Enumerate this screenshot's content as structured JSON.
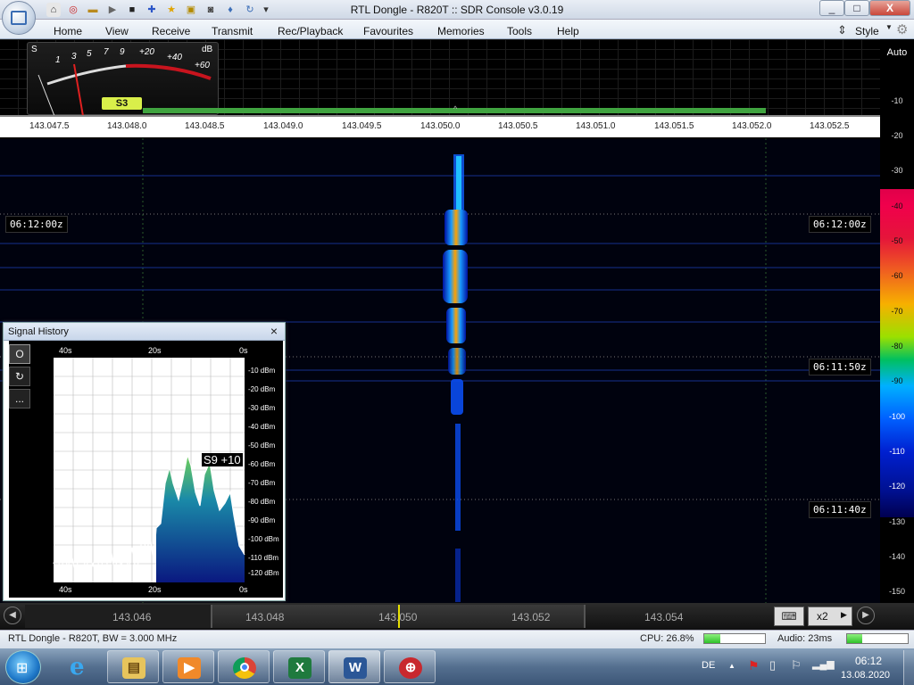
{
  "window": {
    "title": "RTL Dongle - R820T :: SDR Console v3.0.19",
    "controls": [
      "_",
      "□",
      "X"
    ]
  },
  "menu": {
    "items": [
      "Home",
      "View",
      "Receive",
      "Transmit",
      "Rec/Playback",
      "Favourites",
      "Memories",
      "Tools",
      "Help"
    ],
    "style_label": "Style"
  },
  "smeter": {
    "s_label": "S",
    "db_label": "dB",
    "scale_s": [
      "1",
      "3",
      "5",
      "7",
      "9"
    ],
    "scale_db": [
      "+20",
      "+40",
      "+60"
    ],
    "reading": "S3"
  },
  "ruler": {
    "ticks": [
      "143.047.5",
      "143.048.0",
      "143.048.5",
      "143.049.0",
      "143.049.5",
      "143.050.0",
      "143.050.5",
      "143.051.0",
      "143.051.5",
      "143.052.0",
      "143.052.5"
    ]
  },
  "scale": {
    "auto_label": "Auto",
    "values": [
      "-10",
      "-20",
      "-30",
      "-40",
      "-50",
      "-60",
      "-70",
      "-80",
      "-90",
      "-100",
      "-110",
      "-120",
      "-130",
      "-140",
      "-150"
    ]
  },
  "timestamps": [
    "06:12:00z",
    "06:11:50z",
    "06:11:40z"
  ],
  "signal_history": {
    "title": "Signal History",
    "close": "×",
    "buttons": [
      "O",
      "↻",
      "..."
    ],
    "x_labels": [
      "40s",
      "20s",
      "0s"
    ],
    "y_labels": [
      "-10 dBm",
      "-20 dBm",
      "-30 dBm",
      "-40 dBm",
      "-50 dBm",
      "-60 dBm",
      "-70 dBm",
      "-80 dBm",
      "-90 dBm",
      "-100 dBm",
      "-110 dBm",
      "-120 dBm"
    ],
    "peak_label": "S9 +10"
  },
  "tuning": {
    "labels": [
      "143.046",
      "143.048",
      "143.050",
      "143.052",
      "143.054"
    ],
    "zoom": "x2"
  },
  "status": {
    "device": "RTL Dongle - R820T, BW = 3.000 MHz",
    "cpu": "CPU: 26.8%",
    "cpu_level": 0.27,
    "audio": "Audio: 23ms",
    "audio_level": 0.25
  },
  "taskbar": {
    "apps": [
      "internet-explorer",
      "file-explorer",
      "media-player",
      "chrome",
      "excel",
      "word",
      "sdr-console"
    ],
    "language": "DE",
    "time": "06:12",
    "date": "13.08.2020"
  },
  "colors": {
    "accent": "#3fa33f",
    "s3_badge": "#d9ef4a",
    "signal_core": "#ff6a00"
  }
}
